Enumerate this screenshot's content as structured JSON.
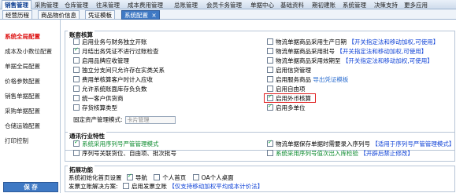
{
  "topnav": [
    "销售管理",
    "采购管理",
    "仓库管理",
    "往来管理",
    "成本费用管理",
    "总账管理",
    "会员卡务管理",
    "单据中心",
    "基础资料",
    "期初建账",
    "系统管理",
    "决策支持",
    "更多应用"
  ],
  "tabs": [
    "经营历程",
    "商品物价信息",
    "凭证模板",
    "系统配置"
  ],
  "tab_close": "×",
  "sidebar": [
    "系统全局配置",
    "成本及小数位配置",
    "单据全局配置",
    "价格参数配置",
    "销售单据配置",
    "采购单据配置",
    "仓储运输配置",
    "打印控制"
  ],
  "save_label": "保 存",
  "account": {
    "title": "账套核算",
    "left": [
      {
        "label": "启用业务与财务独立开账",
        "checked": false
      },
      {
        "label": "月结出务凭证不进行过账检查",
        "checked": true
      },
      {
        "label": "启用品牌应收管理",
        "checked": false
      },
      {
        "label": "独立分支间只允许存在实类关系",
        "checked": false
      },
      {
        "label": "费用单核算客户时计入应收",
        "checked": false
      },
      {
        "label": "允许系统账面库存负负数",
        "checked": false
      },
      {
        "label": "统一客户供货商",
        "checked": false
      },
      {
        "label": "存货核算类型",
        "checked": false
      }
    ],
    "right": [
      {
        "label": "物流单据商品采用生产日期",
        "checked": false,
        "note": "【开关指定法和移动加权,可使用】"
      },
      {
        "label": "物流单据商品采用批号",
        "checked": false,
        "note": "【开关指定法和移动加权,可使用】"
      },
      {
        "label": "物流单据商品采用效期至",
        "checked": false,
        "note": "【开关指定法和移动加权,可使用】"
      },
      {
        "label": "启用信贷管理",
        "checked": false
      },
      {
        "label": "启用服务商品",
        "checked": false,
        "link": "导出凭证模板"
      },
      {
        "label": "启用自由项",
        "checked": false
      },
      {
        "label": "启用外币核算",
        "checked": true
      },
      {
        "label": "启用多单位",
        "checked": true
      }
    ],
    "fixed_label": "固定资产管理模式:",
    "fixed_value": "卡片管理"
  },
  "general": {
    "title": "通讯行业特性",
    "row1_left": {
      "label": "系统采用序列号严管管理模式",
      "checked": true
    },
    "row1_right": {
      "label": "物流单据保存单据时需要录入序列号",
      "checked": true,
      "note": "【适用于序列号严管管理模式】"
    },
    "row2_left": {
      "label": "序列号关联货位、自由项、批次批号",
      "checked": false
    },
    "row2_right": {
      "label": "系统采用序列号值次出入库检验",
      "checked": false,
      "note": "【开辟后禁止修改】"
    }
  },
  "expand": {
    "title": "拓展功能",
    "home_label": "系统初始化首页设置",
    "options": [
      {
        "label": "导航",
        "checked": true
      },
      {
        "label": "个人首页",
        "checked": false
      },
      {
        "label": "OA个人桌面",
        "checked": false
      }
    ],
    "invoice_label": "发票立账解决方案:",
    "invoice_option": "启用发票立账",
    "invoice_note": "【仅支持移动加权平均成本计价法】"
  }
}
